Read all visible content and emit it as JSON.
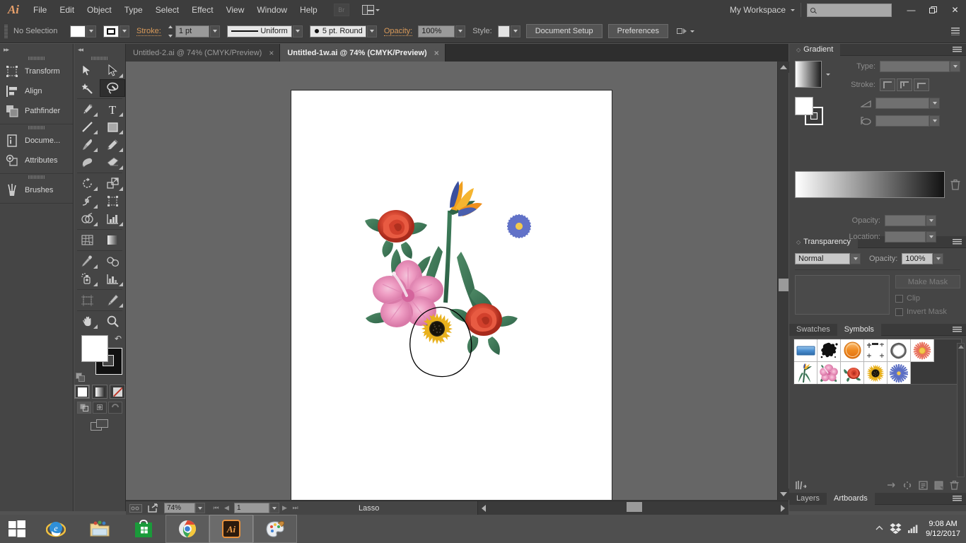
{
  "app": {
    "logo": "Ai",
    "workspace": "My Workspace",
    "search_placeholder": ""
  },
  "menu": {
    "items": [
      "File",
      "Edit",
      "Object",
      "Type",
      "Select",
      "Effect",
      "View",
      "Window",
      "Help"
    ],
    "bridge_label": "Br",
    "arrange_icon": "arrange-documents-icon"
  },
  "window_controls": {
    "minimize": "—",
    "restore": "❐",
    "close": "✕"
  },
  "control_bar": {
    "selection_status": "No Selection",
    "fill_label": "fill-swatch",
    "stroke_swatch_label": "stroke-swatch",
    "stroke_label": "Stroke:",
    "stroke_weight": "1 pt",
    "profile": "Uniform",
    "brush": "5 pt. Round",
    "opacity_label": "Opacity:",
    "opacity_value": "100%",
    "style_label": "Style:",
    "document_setup": "Document Setup",
    "preferences": "Preferences"
  },
  "left_dock": {
    "groups": [
      {
        "items": [
          {
            "label": "Transform",
            "icon": "transform-icon"
          },
          {
            "label": "Align",
            "icon": "align-icon"
          },
          {
            "label": "Pathfinder",
            "icon": "pathfinder-icon"
          }
        ]
      },
      {
        "items": [
          {
            "label": "Docume...",
            "icon": "document-info-icon"
          },
          {
            "label": "Attributes",
            "icon": "attributes-icon"
          }
        ]
      },
      {
        "items": [
          {
            "label": "Brushes",
            "icon": "brushes-icon"
          }
        ]
      }
    ]
  },
  "toolbar": {
    "tools": [
      {
        "name": "selection-tool",
        "active": false,
        "corner": false
      },
      {
        "name": "direct-selection-tool",
        "active": false,
        "corner": true
      },
      {
        "name": "magic-wand-tool",
        "active": false,
        "corner": false
      },
      {
        "name": "lasso-tool",
        "active": true,
        "corner": false
      },
      {
        "name": "pen-tool",
        "active": false,
        "corner": true
      },
      {
        "name": "type-tool",
        "active": false,
        "corner": true
      },
      {
        "name": "line-segment-tool",
        "active": false,
        "corner": true
      },
      {
        "name": "rectangle-tool",
        "active": false,
        "corner": true
      },
      {
        "name": "paintbrush-tool",
        "active": false,
        "corner": true
      },
      {
        "name": "pencil-tool",
        "active": false,
        "corner": true
      },
      {
        "name": "blob-brush-tool",
        "active": false,
        "corner": false
      },
      {
        "name": "eraser-tool",
        "active": false,
        "corner": true
      },
      {
        "name": "rotate-tool",
        "active": false,
        "corner": true
      },
      {
        "name": "scale-tool",
        "active": false,
        "corner": true
      },
      {
        "name": "width-tool",
        "active": false,
        "corner": true
      },
      {
        "name": "free-transform-tool",
        "active": false,
        "corner": false
      },
      {
        "name": "shape-builder-tool",
        "active": false,
        "corner": true
      },
      {
        "name": "column-graph-tool",
        "active": false,
        "corner": true
      },
      {
        "name": "mesh-tool",
        "active": false,
        "corner": false
      },
      {
        "name": "gradient-tool",
        "active": false,
        "corner": false
      },
      {
        "name": "eyedropper-tool",
        "active": false,
        "corner": true
      },
      {
        "name": "blend-tool",
        "active": false,
        "corner": false
      },
      {
        "name": "symbol-sprayer-tool",
        "active": false,
        "corner": true
      },
      {
        "name": "graph-tool",
        "active": false,
        "corner": true
      },
      {
        "name": "artboard-tool",
        "active": false,
        "corner": false
      },
      {
        "name": "slice-tool",
        "active": false,
        "corner": true
      },
      {
        "name": "hand-tool",
        "active": false,
        "corner": true
      },
      {
        "name": "zoom-tool",
        "active": false,
        "corner": false
      }
    ],
    "fill_color": "#ffffff",
    "stroke_color": "#000000",
    "paint_modes": [
      "solid-color",
      "gradient",
      "none"
    ],
    "draw_modes": [
      "draw-normal",
      "draw-behind",
      "draw-inside"
    ],
    "screen_mode": "change-screen-mode"
  },
  "document_tabs": [
    {
      "title": "Untitled-2.ai @ 74% (CMYK/Preview)",
      "active": false,
      "close": "×"
    },
    {
      "title": "Untitled-1w.ai @ 74% (CMYK/Preview)",
      "active": true,
      "close": "×"
    }
  ],
  "status_bar": {
    "zoom": "74%",
    "page": "1",
    "tool_status": "Lasso"
  },
  "panels": {
    "gradient": {
      "title": "Gradient",
      "type_label": "Type:",
      "type_value": "",
      "stroke_label": "Stroke:",
      "angle_value": "",
      "aspect_value": "",
      "opacity_label": "Opacity:",
      "opacity_value": "",
      "location_label": "Location:",
      "location_value": "",
      "gradient_from": "#ffffff",
      "gradient_to": "#121212"
    },
    "transparency": {
      "title": "Transparency",
      "blend_mode": "Normal",
      "opacity_label": "Opacity:",
      "opacity_value": "100%",
      "make_mask": "Make Mask",
      "clip_label": "Clip",
      "invert_mask_label": "Invert Mask"
    },
    "symbols": {
      "tabs": [
        {
          "label": "Swatches",
          "active": false
        },
        {
          "label": "Symbols",
          "active": true
        }
      ],
      "items": [
        {
          "name": "blue-gradient-rectangle-symbol"
        },
        {
          "name": "ink-splatter-symbol"
        },
        {
          "name": "orange-button-symbol"
        },
        {
          "name": "crop-marks-symbol"
        },
        {
          "name": "grey-ribbon-ring-symbol"
        },
        {
          "name": "coral-daisy-symbol"
        },
        {
          "name": "bird-of-paradise-symbol"
        },
        {
          "name": "pink-hibiscus-symbol"
        },
        {
          "name": "red-rose-symbol"
        },
        {
          "name": "sunflower-symbol"
        },
        {
          "name": "blue-aster-symbol"
        }
      ],
      "tools": [
        "symbol-libraries-menu",
        "place-symbol-instance",
        "break-link",
        "symbol-options",
        "new-symbol",
        "delete-symbol"
      ]
    },
    "bottom_tabs": [
      {
        "label": "Layers",
        "active": false
      },
      {
        "label": "Artboards",
        "active": true
      }
    ]
  },
  "artwork": {
    "description": "flower-illustration-artboard",
    "objects": [
      "red-rose-top-left",
      "bird-of-paradise",
      "blue-aster",
      "pink-hibiscus",
      "red-rose-right",
      "sunflower",
      "lasso-selection-path"
    ]
  },
  "taskbar": {
    "items": [
      {
        "name": "start-button",
        "state": "normal"
      },
      {
        "name": "internet-explorer-icon",
        "state": "normal"
      },
      {
        "name": "file-explorer-icon",
        "state": "normal"
      },
      {
        "name": "microsoft-store-icon",
        "state": "normal"
      },
      {
        "name": "google-chrome-icon",
        "state": "open"
      },
      {
        "name": "illustrator-icon",
        "state": "active"
      },
      {
        "name": "paint-icon",
        "state": "open"
      }
    ],
    "tray": {
      "show_hidden": "show-hidden-icons",
      "dropbox": "dropbox-icon",
      "network": "network-icon",
      "time": "9:08 AM",
      "date": "9/12/2017"
    }
  }
}
